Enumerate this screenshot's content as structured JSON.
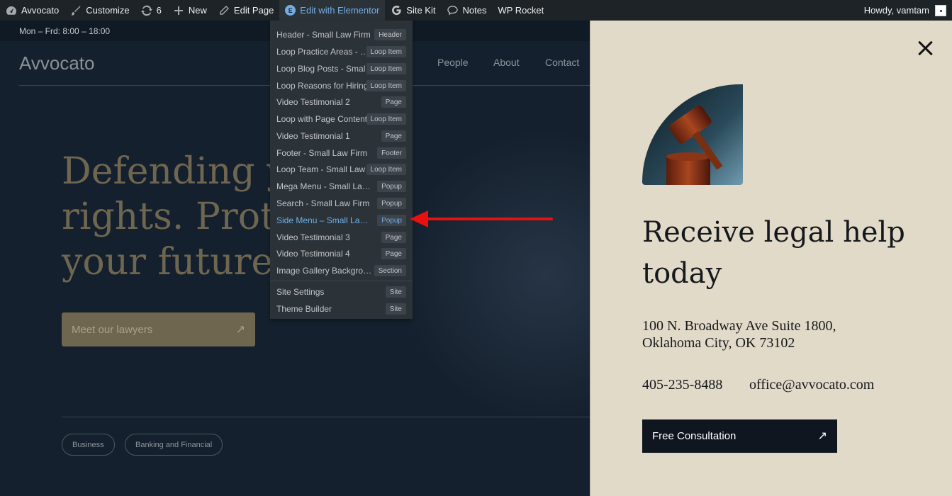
{
  "adminbar": {
    "site_name": "Avvocato",
    "customize": "Customize",
    "updates": "6",
    "new": "New",
    "edit_page": "Edit Page",
    "edit_elementor": "Edit with Elementor",
    "site_kit": "Site Kit",
    "notes": "Notes",
    "wp_rocket": "WP Rocket",
    "howdy": "Howdy, vamtam"
  },
  "site": {
    "hours": "Mon – Frd: 8:00 – 18:00",
    "logo": "Avvocato",
    "nav": [
      "People",
      "About",
      "Contact"
    ],
    "hero": [
      "Defending yo",
      "rights. Prote",
      "your future."
    ],
    "cta": "Meet our lawyers",
    "chips": [
      "Business",
      "Banking and Financial"
    ]
  },
  "dropdown": {
    "items": [
      {
        "label": "Header - Small Law Firm",
        "badge": "Header"
      },
      {
        "label": "Loop Practice Areas - Small Law Firm",
        "badge": "Loop Item"
      },
      {
        "label": "Loop Blog Posts - Small Law Firm",
        "badge": "Loop Item"
      },
      {
        "label": "Loop Reasons for Hiring",
        "badge": "Loop Item"
      },
      {
        "label": "Video Testimonial 2",
        "badge": "Page"
      },
      {
        "label": "Loop with Page Content",
        "badge": "Loop Item"
      },
      {
        "label": "Video Testimonial 1",
        "badge": "Page"
      },
      {
        "label": "Footer - Small Law Firm",
        "badge": "Footer"
      },
      {
        "label": "Loop Team - Small Law Firm",
        "badge": "Loop Item"
      },
      {
        "label": "Mega Menu - Small Law Firm",
        "badge": "Popup"
      },
      {
        "label": "Search - Small Law Firm",
        "badge": "Popup"
      },
      {
        "label": "Side Menu – Small Law Firm",
        "badge": "Popup"
      },
      {
        "label": "Video Testimonial 3",
        "badge": "Page"
      },
      {
        "label": "Video Testimonial 4",
        "badge": "Page"
      },
      {
        "label": "Image Gallery Background",
        "badge": "Section"
      }
    ],
    "footer_items": [
      {
        "label": "Site Settings",
        "badge": "Site"
      },
      {
        "label": "Theme Builder",
        "badge": "Site"
      }
    ]
  },
  "panel": {
    "title": "Receive legal help today",
    "address_line1": "100 N. Broadway Ave Suite 1800,",
    "address_line2": "Oklahoma City, OK 73102",
    "phone": "405-235-8488",
    "email": "office@avvocato.com",
    "button": "Free Consultation"
  },
  "colors": {
    "accent": "#72aee6",
    "panel_bg": "#e2dac8",
    "arrow": "#e81010"
  }
}
